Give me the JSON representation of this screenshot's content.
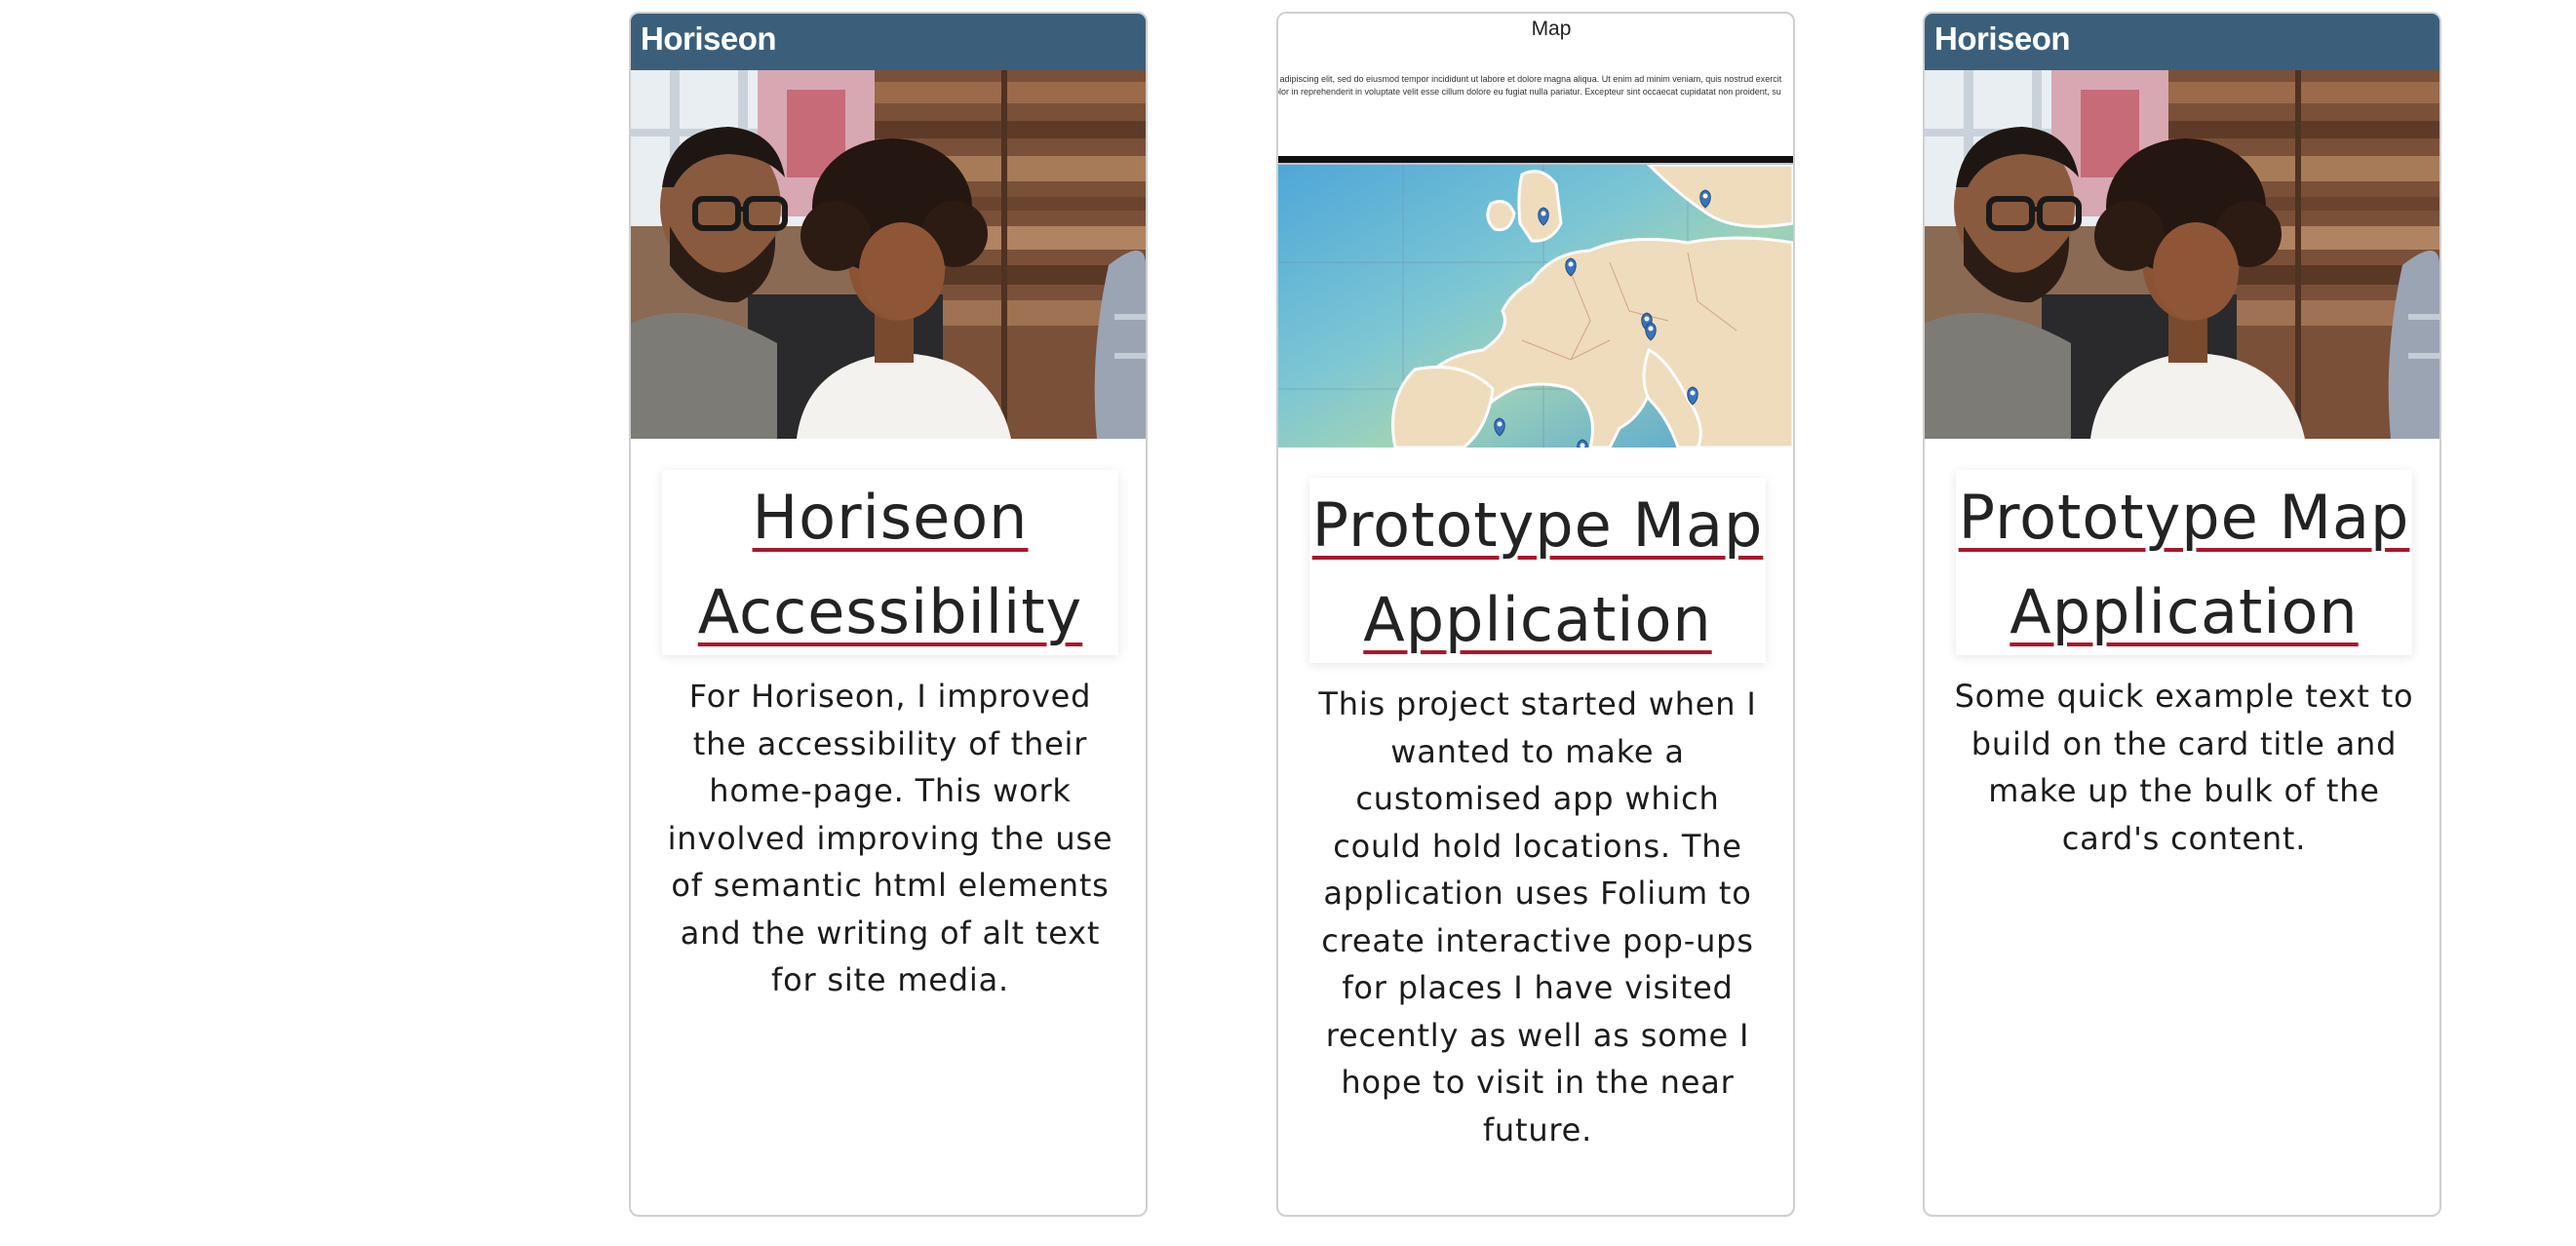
{
  "cards": [
    {
      "thumbnail": {
        "logo_text": "Horiseon",
        "header_color": "#3b5f7b"
      },
      "title": "Horiseon Accessibility",
      "description": "For Horiseon, I improved the accessibility of their home-page. This work involved improving the use of semantic html elements and the writing of alt text for site media."
    },
    {
      "thumbnail": {
        "map_title": "Map",
        "lorem_line_1": "r adipiscing elit, sed do eiusmod tempor incididunt ut labore et dolore magna aliqua. Ut enim ad minim veniam, quis nostrud exercit",
        "lorem_line_2": "olor in reprehenderit in voluptate velit esse cillum dolore eu fugiat nulla pariatur. Excepteur sint occaecat cupidatat non proident, su"
      },
      "title": "Prototype Map Application",
      "description": "This project started when I wanted to make a customised app which could hold locations. The application uses Folium to create interactive pop-ups for places I have visited recently as well as some I hope to visit in the near future."
    },
    {
      "thumbnail": {
        "logo_text": "Horiseon",
        "header_color": "#3b5f7b"
      },
      "title": "Prototype Map Application",
      "description": "Some quick example text to build on the card title and make up the bulk of the card's content."
    }
  ],
  "colors": {
    "link_underline": "#a9172f",
    "card_border": "#cfcfcf"
  }
}
